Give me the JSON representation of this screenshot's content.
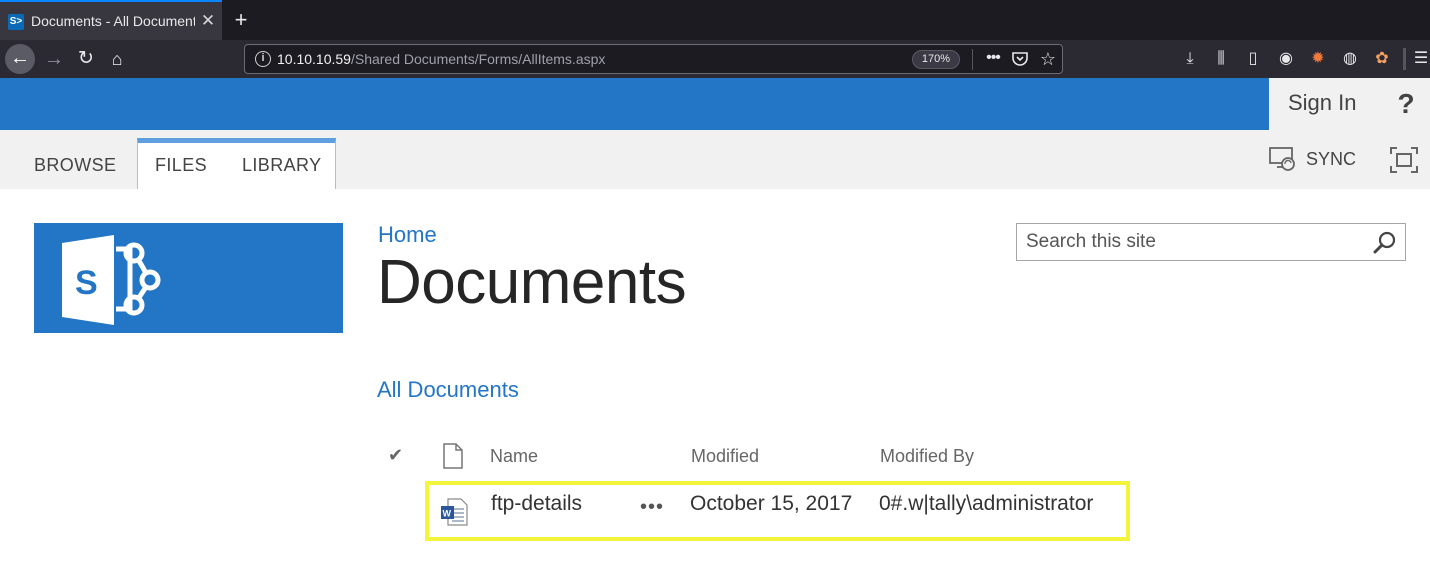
{
  "browser": {
    "tab_title": "Documents - All Documents",
    "tab_favicon_text": "S>",
    "url_host": "10.10.10.59",
    "url_path": "/Shared Documents/Forms/AllItems.aspx",
    "zoom": "170%"
  },
  "suite": {
    "signin_label": "Sign In",
    "help_label": "?"
  },
  "ribbon": {
    "tabs": [
      "BROWSE",
      "FILES",
      "LIBRARY"
    ],
    "sync_label": "SYNC"
  },
  "page": {
    "breadcrumb": "Home",
    "title": "Documents",
    "search_placeholder": "Search this site",
    "view_link": "All Documents"
  },
  "table": {
    "columns": [
      "Name",
      "Modified",
      "Modified By"
    ],
    "rows": [
      {
        "name": "ftp-details",
        "modified": "October 15, 2017",
        "modified_by": "0#.w|tally\\administrator",
        "file_type": "word-document"
      }
    ]
  },
  "colors": {
    "suite_blue": "#2376c6",
    "highlight_yellow": "#f4f43d",
    "browser_dark": "#1c1b22"
  }
}
